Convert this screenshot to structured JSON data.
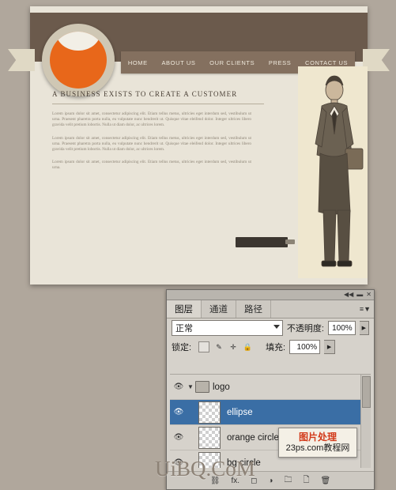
{
  "mockup": {
    "nav_items": [
      "HOME",
      "ABOUT US",
      "OUR CLIENTS",
      "PRESS",
      "CONTACT US"
    ],
    "headline": "A BUSINESS EXISTS TO CREATE A CUSTOMER",
    "paragraph1": "Lorem ipsum dolor sit amet, consectetur adipiscing elit. Etiam tellus metus, ultricies eget interdum sed, vestibulum ut urna. Praesent pharetra porta nulla, eu vulputate nunc hendrerit ut. Quisque vitae eleifend dolor. Integer ultrices libero gravida velit pretium lobortis. Nulla ut diam dolor, ac ultrices lorem.",
    "paragraph2": "Lorem ipsum dolor sit amet, consectetur adipiscing elit. Etiam tellus metus, ultricies eget interdum sed, vestibulum ut urna. Praesent pharetra porta nulla, eu vulputate nunc hendrerit ut. Quisque vitae eleifend dolor. Integer ultrices libero gravida velit pretium lobortis. Nulla ut diam dolor, ac ultrices lorem.",
    "paragraph3": "Lorem ipsum dolor sit amet, consectetur adipiscing elit. Etiam tellus metus, ultricies eget interdum sed, vestibulum ut urna.",
    "accent_color": "#e8671a",
    "header_color": "#6b5a4c"
  },
  "photoshop": {
    "titlebar": {
      "collapse_icon": "◀◀",
      "minimize_icon": "▬",
      "close_icon": "✕"
    },
    "tabs": [
      {
        "label": "图层",
        "active": true
      },
      {
        "label": "通道",
        "active": false
      },
      {
        "label": "路径",
        "active": false
      }
    ],
    "panel_menu_icon": "≡▼",
    "blend_mode": "正常",
    "opacity_label": "不透明度:",
    "opacity_value": "100%",
    "lock_label": "锁定:",
    "fill_label": "填充:",
    "fill_value": "100%",
    "lock_icons": [
      "transparency-lock",
      "brush-lock",
      "move-lock",
      "all-lock"
    ],
    "layers": [
      {
        "name": "logo",
        "type": "group",
        "visible": true,
        "selected": false,
        "expanded": true,
        "indent": 0
      },
      {
        "name": "ellipse",
        "type": "layer",
        "visible": true,
        "selected": true,
        "indent": 1
      },
      {
        "name": "orange circle",
        "type": "layer",
        "visible": true,
        "selected": false,
        "indent": 1
      },
      {
        "name": "bg circle",
        "type": "layer",
        "visible": true,
        "selected": false,
        "indent": 1
      }
    ],
    "footer_icons": [
      "link-icon",
      "fx-icon",
      "mask-icon",
      "adjustment-icon",
      "folder-icon",
      "new-layer-icon",
      "delete-icon"
    ],
    "selection_color": "#3a6ea5"
  },
  "watermarks": {
    "box_line1": "图片处理",
    "box_line2": "23ps.com教程网",
    "bottom": "UiBQ.CoM"
  }
}
